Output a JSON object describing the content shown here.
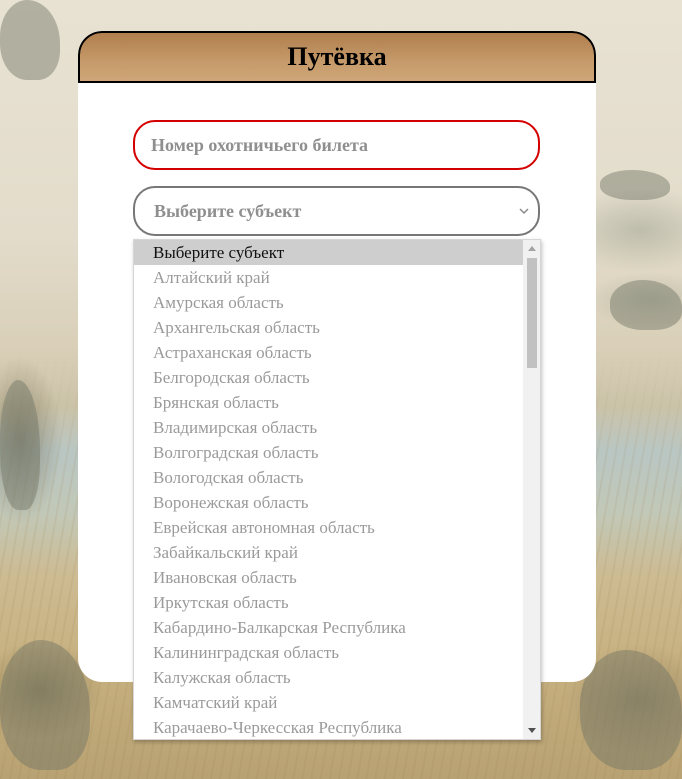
{
  "form": {
    "title": "Путёвка",
    "ticket_placeholder": "Номер охотничьего билета",
    "subject_select_value": "Выберите субъект"
  },
  "dropdown": {
    "options": [
      "Выберите субъект",
      "Алтайский край",
      "Амурская область",
      "Архангельская область",
      "Астраханская область",
      "Белгородская область",
      "Брянская область",
      "Владимирская область",
      "Волгоградская область",
      "Вологодская область",
      "Воронежская область",
      "Еврейская автономная область",
      "Забайкальский край",
      "Ивановская область",
      "Иркутская область",
      "Кабардино-Балкарская Республика",
      "Калининградская область",
      "Калужская область",
      "Камчатский край",
      "Карачаево-Черкесская Республика"
    ],
    "selected_index": 0
  },
  "colors": {
    "header_brown": "#c18f5e",
    "ticket_border": "#d40000",
    "select_border": "#777777",
    "selected_option_bg": "#cecece"
  },
  "icons": {
    "select_arrow": "chevron-down-icon",
    "scroll_up": "triangle-up-icon",
    "scroll_down": "triangle-down-icon"
  }
}
